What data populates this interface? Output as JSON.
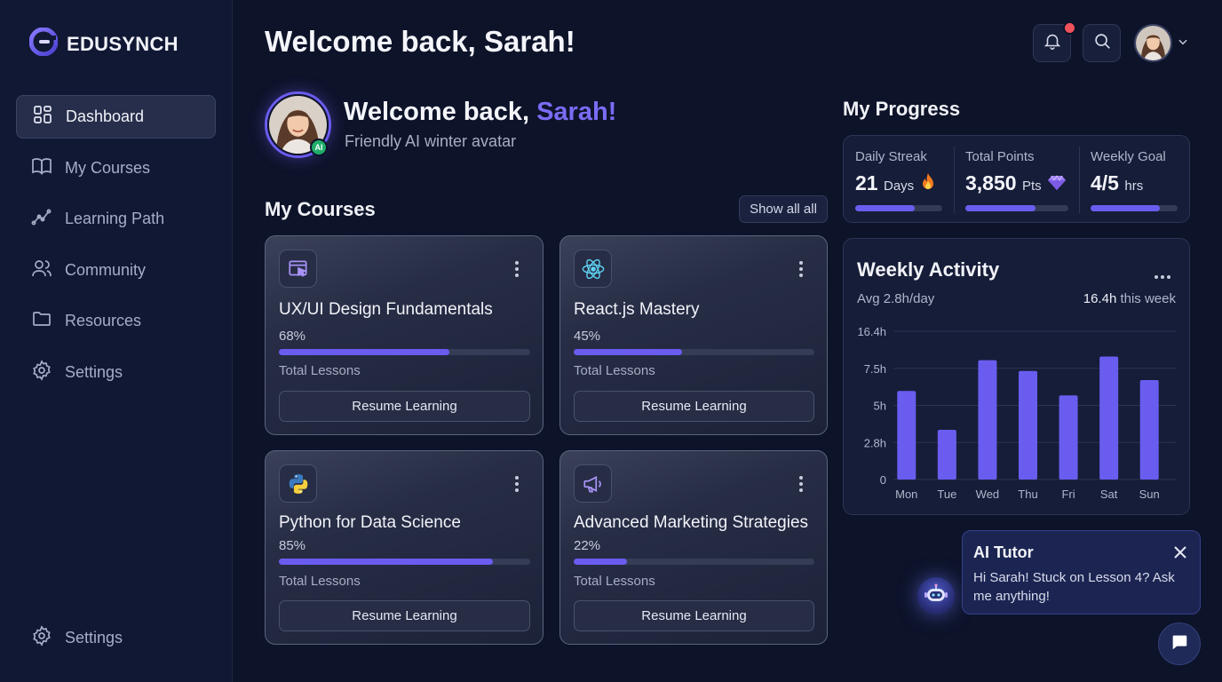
{
  "brand": {
    "name": "EDUSYNCH",
    "icon": "logo-icon"
  },
  "sidebar": {
    "items": [
      {
        "label": "Dashboard",
        "icon": "grid-icon",
        "active": true
      },
      {
        "label": "My Courses",
        "icon": "book-icon"
      },
      {
        "label": "Learning Path",
        "icon": "path-icon"
      },
      {
        "label": "Community",
        "icon": "users-icon"
      },
      {
        "label": "Resources",
        "icon": "folder-icon"
      },
      {
        "label": "Settings",
        "icon": "gear-icon"
      }
    ],
    "footer_label": "Settings"
  },
  "header": {
    "title": "Welcome back, Sarah!",
    "notification_icon": "bell-icon",
    "search_icon": "search-icon"
  },
  "hero": {
    "greeting": "Welcome back, ",
    "name": "Sarah!",
    "subtitle": "Friendly AI winter avatar",
    "badge": "AI"
  },
  "courses": {
    "title": "My Courses",
    "show_all_label": "Show all all",
    "items": [
      {
        "title": "UX/UI Design Fundamentals",
        "percent_label": "68%",
        "progress": 0.68,
        "lessons_label": "Total Lessons",
        "button": "Resume Learning",
        "icon": "design-icon"
      },
      {
        "title": "React.js Mastery",
        "percent_label": "45%",
        "progress": 0.45,
        "lessons_label": "Total Lessons",
        "button": "Resume Learning",
        "icon": "react-icon"
      },
      {
        "title": "Python for Data Science",
        "percent_label": "85%",
        "progress": 0.85,
        "lessons_label": "Total Lessons",
        "button": "Resume Learning",
        "icon": "python-icon"
      },
      {
        "title": "Advanced Marketing Strategies",
        "percent_label": "22%",
        "progress": 0.22,
        "lessons_label": "Total Lessons",
        "button": "Resume Learning",
        "icon": "megaphone-icon"
      }
    ]
  },
  "progress": {
    "title": "My Progress",
    "stats": [
      {
        "label": "Daily Streak",
        "value": "21",
        "unit": "Days",
        "icon": "fire-icon",
        "fill": 0.68
      },
      {
        "label": "Total Points",
        "value": "3,850",
        "unit": "Pts",
        "icon": "gem-icon",
        "fill": 0.68
      },
      {
        "label": "Weekly Goal",
        "value": "4/5",
        "unit": "hrs",
        "icon": "",
        "fill": 0.8
      }
    ]
  },
  "activity": {
    "title": "Weekly Activity",
    "avg": "Avg 2.8h/day",
    "total_value": "16.4h",
    "total_suffix": " this week"
  },
  "chart_data": {
    "type": "bar",
    "categories": [
      "Mon",
      "Tue",
      "Wed",
      "Thu",
      "Fri",
      "Sat",
      "Sun"
    ],
    "values": [
      9.8,
      5.5,
      13.2,
      12.0,
      9.3,
      13.6,
      11.0
    ],
    "y_ticks": [
      "16.4h",
      "7.5h",
      "5h",
      "2.8h",
      "0"
    ],
    "ylim": [
      0,
      16.4
    ],
    "bar_color": "#6b5cf0",
    "grid": true
  },
  "tutor": {
    "title": "AI Tutor",
    "message": "Hi Sarah! Stuck on Lesson 4? Ask me anything!"
  },
  "colors": {
    "accent": "#6b5cf0",
    "background": "#0d1329",
    "notification": "#f0525b"
  }
}
